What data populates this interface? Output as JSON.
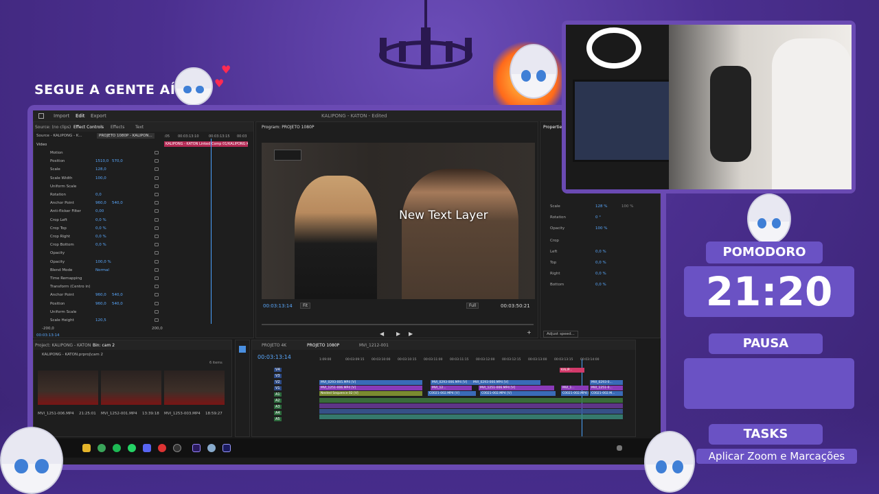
{
  "overlay": {
    "headline": "SEGUE A GENTE AÍ",
    "pomodoro_label": "POMODORO",
    "timer": "21:20",
    "pause_label": "PAUSA",
    "pause_value": "",
    "tasks_label": "TASKS",
    "task_current": "Aplicar Zoom e Marcações",
    "accent_color": "#6a52c4"
  },
  "premiere": {
    "menu": [
      "Import",
      "Edit",
      "Export"
    ],
    "title": "KALIPONG - KATON - Edited",
    "effect_controls": {
      "tabs": [
        "Source: (no clips)",
        "Effect Controls",
        "Effects",
        "Text"
      ],
      "source_clip": "Source - KALIPONG - K...",
      "sequence_clip": "PROJETO 1080P - KALIPON...",
      "timecodes": [
        ":05",
        "00:03:13:10",
        "00:03:13:15",
        "00:03"
      ],
      "clip_bar": "KALIPONG - KATON Linked Comp 01/KALIPONG K",
      "section": "Video",
      "rows": [
        {
          "label": "Motion",
          "v1": "",
          "v2": ""
        },
        {
          "label": "Position",
          "v1": "1510,0",
          "v2": "570,0"
        },
        {
          "label": "Scale",
          "v1": "128,0",
          "v2": ""
        },
        {
          "label": "Scale Width",
          "v1": "100,0",
          "v2": ""
        },
        {
          "label": "Uniform Scale",
          "v1": "",
          "v2": ""
        },
        {
          "label": "Rotation",
          "v1": "0,0",
          "v2": ""
        },
        {
          "label": "Anchor Point",
          "v1": "960,0",
          "v2": "540,0"
        },
        {
          "label": "Anti-flicker Filter",
          "v1": "0,00",
          "v2": ""
        },
        {
          "label": "Crop Left",
          "v1": "0,0 %",
          "v2": ""
        },
        {
          "label": "Crop Top",
          "v1": "0,0 %",
          "v2": ""
        },
        {
          "label": "Crop Right",
          "v1": "0,0 %",
          "v2": ""
        },
        {
          "label": "Crop Bottom",
          "v1": "0,0 %",
          "v2": ""
        },
        {
          "label": "Opacity",
          "v1": "",
          "v2": ""
        },
        {
          "label": "Opacity",
          "v1": "100,0 %",
          "v2": ""
        },
        {
          "label": "Blend Mode",
          "v1": "Normal",
          "v2": ""
        },
        {
          "label": "Time Remapping",
          "v1": "",
          "v2": ""
        },
        {
          "label": "Transform (Centro in)",
          "v1": "",
          "v2": ""
        },
        {
          "label": "Anchor Point",
          "v1": "960,0",
          "v2": "540,0"
        },
        {
          "label": "Position",
          "v1": "960,0",
          "v2": "540,0"
        },
        {
          "label": "Uniform Scale",
          "v1": "",
          "v2": ""
        },
        {
          "label": "Scale Height",
          "v1": "120,5",
          "v2": ""
        }
      ],
      "range_left": "-200,0",
      "range_right": "200,0",
      "current_tc": "00:03:13:14"
    },
    "program": {
      "title": "Program: PROJETO 1080P",
      "text_layer": "New Text Layer",
      "tc_left": "00:03:13:14",
      "fit": "Fit",
      "quality": "Full",
      "tc_right": "00:03:50:21"
    },
    "properties": {
      "title": "Properties",
      "rows": [
        {
          "label": "Scale",
          "value": "128 %",
          "extra": "100 %"
        },
        {
          "label": "Rotation",
          "value": "0 °",
          "extra": ""
        },
        {
          "label": "Opacity",
          "value": "100 %",
          "extra": ""
        },
        {
          "label": "Crop",
          "value": "",
          "extra": ""
        },
        {
          "label": "Left",
          "value": "0,0 %",
          "extra": ""
        },
        {
          "label": "Top",
          "value": "0,0 %",
          "extra": ""
        },
        {
          "label": "Right",
          "value": "0,0 %",
          "extra": ""
        },
        {
          "label": "Bottom",
          "value": "0,0 %",
          "extra": ""
        }
      ],
      "adjust_speed": "Adjust speed..."
    },
    "project": {
      "tabs": [
        "Project: KALIPONG - KATON",
        "Bin: cam 2"
      ],
      "path": "KALIPONG - KATON.prproj\\cam 2",
      "count": "6 items",
      "thumbs": [
        {
          "name": "MVI_1251-006.MP4",
          "dur": "21:25:01"
        },
        {
          "name": "MVI_1252-001.MP4",
          "dur": "13:39:18"
        },
        {
          "name": "MVI_1253-003.MP4",
          "dur": "18:59:27"
        }
      ]
    },
    "timeline": {
      "tabs": [
        "PROJETO 4K",
        "PROJETO 1080P",
        "MVI_1212-001"
      ],
      "tc": "00:03:13:14",
      "ruler": [
        "1:09:00",
        "00:03:09:15",
        "00:03:10:00",
        "00:03:10:15",
        "00:03:11:00",
        "00:03:11:15",
        "00:03:12:00",
        "00:03:12:15",
        "00:03:13:00",
        "00:03:13:15",
        "00:03:14:00"
      ],
      "tracks": [
        "V4",
        "V3",
        "V2",
        "V1",
        "A1",
        "A2",
        "A3",
        "A4",
        "A5"
      ],
      "clips": {
        "v3_a": "MVI_0293-005.MP4 [V]",
        "v3_b": "MVI_0293-006.MP4 [V]",
        "v3_c": "MVI_0293-000.MP4 [V]",
        "v3_d": "MVI_0293-0...",
        "v2_a": "MVI_1251-006.MP4 [V]",
        "v2_b": "MVI_12...",
        "v2_c": "MVI_1251-006.MP4 [V]",
        "v2_d": "MVI_1...",
        "v2_e": "MVI_1251-0...",
        "v1_a": "Nested Sequence 02 [V]",
        "v1_b": "C0021-002.MP4 [V]",
        "v1_c": "C0021-002.MP4 [V]",
        "v1_d": "C0021-002.MP4 [V]",
        "v1_e": "C0021-002.M...",
        "v4_a": "KALIP..."
      }
    }
  }
}
